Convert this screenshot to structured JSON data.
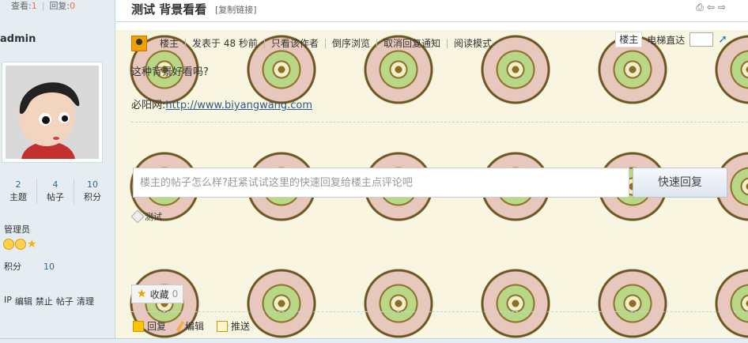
{
  "stats": {
    "views_label": "查看:",
    "views": "1",
    "replies_label": "回复:",
    "replies": "0"
  },
  "thread": {
    "title": "测试 背景看看",
    "copy_link": "[复制链接]"
  },
  "author": {
    "name": "admin",
    "topics": "2",
    "topics_label": "主题",
    "posts": "4",
    "posts_label": "帖子",
    "credits": "10",
    "credits_label": "积分",
    "role": "管理员",
    "score_label": "积分",
    "score": "10"
  },
  "admin_links": [
    "IP",
    "编辑",
    "禁止",
    "帖子",
    "清理"
  ],
  "post_bar": {
    "owner_label": "楼主",
    "posted": "发表于 48 秒前",
    "only_author": "只看该作者",
    "reverse": "倒序浏览",
    "cancel_notify": "取消回复通知",
    "read_mode": "阅读模式"
  },
  "floor_tools": {
    "floor": "楼主",
    "elevator": "电梯直达"
  },
  "post": {
    "line1": "这种背景好看吗?",
    "line2_prefix": "必阳网:",
    "link_text": "http://www.biyangwang.com"
  },
  "quick_reply": {
    "placeholder": "楼主的帖子怎么样?赶紧试试这里的快速回复给楼主点评论吧",
    "button": "快速回复"
  },
  "tag": "测试",
  "favorite": {
    "label": "收藏",
    "count": "0"
  },
  "actions": {
    "reply": "回复",
    "edit": "编辑",
    "push": "推送"
  },
  "icons": [
    "print-icon",
    "prev-arrow-icon",
    "next-arrow-icon",
    "user-icon",
    "jump-icon",
    "tag-icon",
    "star-icon",
    "reply-icon",
    "edit-icon",
    "push-icon"
  ],
  "colors": {
    "accent_num": "#f26c4f",
    "side_bg": "#e5edf2",
    "link": "#2b5a8a"
  }
}
